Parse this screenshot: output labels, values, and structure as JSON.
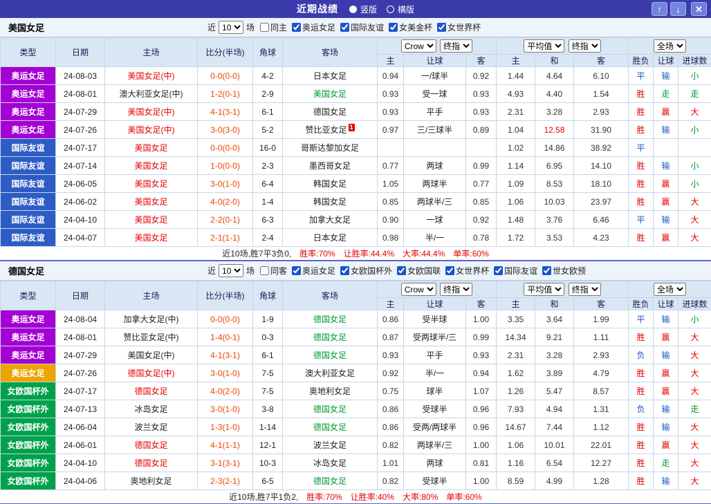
{
  "titlebar": {
    "title": "近期战绩",
    "layout_radios": [
      {
        "label": "竖版",
        "selected": true
      },
      {
        "label": "横版",
        "selected": false
      }
    ],
    "up_button": "↑",
    "down_button": "↓",
    "close_button": "✕"
  },
  "colors": {
    "accent": "#3b3bab",
    "type_purple": "#a400d3",
    "type_blue": "#2d5cc5",
    "type_green": "#00a14b",
    "type_gold": "#eba400",
    "team_red": "#e60000",
    "team_green": "#009933",
    "team_dark": "#222222",
    "score_red": "#ee4400",
    "result_red": "#e60000",
    "result_blue": "#1a56c8",
    "result_green": "#009933",
    "highlight_red": "#e60000"
  },
  "table_header": {
    "static_cols": [
      "类型",
      "日期",
      "主场",
      "比分(半场)",
      "角球",
      "客场"
    ],
    "odds1_cols": [
      "主",
      "让球",
      "客"
    ],
    "odds2_cols": [
      "主",
      "和",
      "客"
    ],
    "result_cols": [
      "胜负",
      "让球",
      "进球数"
    ]
  },
  "sections": [
    {
      "team": "美国女足",
      "filter": {
        "near": "近",
        "count": "10",
        "unit": "场",
        "checkboxes": [
          {
            "label": "同主",
            "checked": false
          },
          {
            "label": "奥运女足",
            "checked": true
          },
          {
            "label": "国际友谊",
            "checked": true
          },
          {
            "label": "女美金杯",
            "checked": true
          },
          {
            "label": "女世界杯",
            "checked": true
          }
        ]
      },
      "controls": {
        "bookmaker": "Crow",
        "odds1_mode": "终指",
        "avg": "平均值",
        "odds2_mode": "终指",
        "scope": "全场"
      },
      "rows": [
        {
          "type": "奥运女足",
          "tcolor": "purple",
          "date": "24-08-03",
          "home": "美国女足(中)",
          "homeColor": "red",
          "score": "0-0(0-0)",
          "corner": "4-2",
          "away": "日本女足",
          "awayColor": "dark",
          "o1": "0.94",
          "handicap": "一/球半",
          "o2": "0.92",
          "avg1": "1.44",
          "avg2": "4.64",
          "avg3": "6.10",
          "res1": "平",
          "res2": "输",
          "res3": "小"
        },
        {
          "type": "奥运女足",
          "tcolor": "purple",
          "date": "24-08-01",
          "home": "澳大利亚女足(中)",
          "homeColor": "dark",
          "score": "1-2(0-1)",
          "corner": "2-9",
          "away": "美国女足",
          "awayColor": "green",
          "o1": "0.93",
          "handicap": "受一球",
          "o2": "0.93",
          "avg1": "4.93",
          "avg2": "4.40",
          "avg3": "1.54",
          "res1": "胜",
          "res2": "走",
          "res3": "走"
        },
        {
          "type": "奥运女足",
          "tcolor": "purple",
          "date": "24-07-29",
          "home": "美国女足(中)",
          "homeColor": "red",
          "score": "4-1(3-1)",
          "corner": "6-1",
          "away": "德国女足",
          "awayColor": "dark",
          "o1": "0.93",
          "handicap": "平手",
          "o2": "0.93",
          "avg1": "2.31",
          "avg2": "3.28",
          "avg3": "2.93",
          "res1": "胜",
          "res2": "赢",
          "res3": "大"
        },
        {
          "type": "奥运女足",
          "tcolor": "purple",
          "date": "24-07-26",
          "home": "美国女足(中)",
          "homeColor": "red",
          "score": "3-0(3-0)",
          "corner": "5-2",
          "away": "赞比亚女足",
          "awayColor": "dark",
          "badge": "1",
          "o1": "0.97",
          "handicap": "三/三球半",
          "o2": "0.89",
          "avg1": "1.04",
          "avg2": "12.58",
          "avg3": "31.90",
          "hl": [
            "avg2"
          ],
          "res1": "胜",
          "res2": "输",
          "res3": "小"
        },
        {
          "type": "国际友谊",
          "tcolor": "blue",
          "date": "24-07-17",
          "home": "美国女足",
          "homeColor": "red",
          "score": "0-0(0-0)",
          "corner": "16-0",
          "away": "哥斯达黎加女足",
          "awayColor": "dark",
          "o1": "",
          "handicap": "",
          "o2": "",
          "avg1": "1.02",
          "avg2": "14.86",
          "avg3": "38.92",
          "res1": "平",
          "res2": "",
          "res3": ""
        },
        {
          "type": "国际友谊",
          "tcolor": "blue",
          "date": "24-07-14",
          "home": "美国女足",
          "homeColor": "red",
          "score": "1-0(0-0)",
          "corner": "2-3",
          "away": "墨西哥女足",
          "awayColor": "dark",
          "o1": "0.77",
          "handicap": "两球",
          "o2": "0.99",
          "avg1": "1.14",
          "avg2": "6.95",
          "avg3": "14.10",
          "res1": "胜",
          "res2": "输",
          "res3": "小"
        },
        {
          "type": "国际友谊",
          "tcolor": "blue",
          "date": "24-06-05",
          "home": "美国女足",
          "homeColor": "red",
          "score": "3-0(1-0)",
          "corner": "6-4",
          "away": "韩国女足",
          "awayColor": "dark",
          "o1": "1.05",
          "handicap": "两球半",
          "o2": "0.77",
          "avg1": "1.09",
          "avg2": "8.53",
          "avg3": "18.10",
          "res1": "胜",
          "res2": "赢",
          "res3": "小"
        },
        {
          "type": "国际友谊",
          "tcolor": "blue",
          "date": "24-06-02",
          "home": "美国女足",
          "homeColor": "red",
          "score": "4-0(2-0)",
          "corner": "1-4",
          "away": "韩国女足",
          "awayColor": "dark",
          "o1": "0.85",
          "handicap": "两球半/三",
          "o2": "0.85",
          "avg1": "1.06",
          "avg2": "10.03",
          "avg3": "23.97",
          "res1": "胜",
          "res2": "赢",
          "res3": "大"
        },
        {
          "type": "国际友谊",
          "tcolor": "blue",
          "date": "24-04-10",
          "home": "美国女足",
          "homeColor": "red",
          "score": "2-2(0-1)",
          "corner": "6-3",
          "away": "加拿大女足",
          "awayColor": "dark",
          "o1": "0.90",
          "handicap": "一球",
          "o2": "0.92",
          "avg1": "1.48",
          "avg2": "3.76",
          "avg3": "6.46",
          "res1": "平",
          "res2": "输",
          "res3": "大"
        },
        {
          "type": "国际友谊",
          "tcolor": "blue",
          "date": "24-04-07",
          "home": "美国女足",
          "homeColor": "red",
          "score": "2-1(1-1)",
          "corner": "2-4",
          "away": "日本女足",
          "awayColor": "dark",
          "o1": "0.98",
          "handicap": "半/一",
          "o2": "0.78",
          "avg1": "1.72",
          "avg2": "3.53",
          "avg3": "4.23",
          "res1": "胜",
          "res2": "赢",
          "res3": "大"
        }
      ],
      "summary": {
        "prefix": "近10场,胜7平3负0,",
        "stats": [
          "胜率:70%",
          "让胜率:44.4%",
          "大率:44.4%",
          "单率:60%"
        ]
      }
    },
    {
      "team": "德国女足",
      "filter": {
        "near": "近",
        "count": "10",
        "unit": "场",
        "checkboxes": [
          {
            "label": "同客",
            "checked": false
          },
          {
            "label": "奥运女足",
            "checked": true
          },
          {
            "label": "女欧国杯外",
            "checked": true
          },
          {
            "label": "女欧国联",
            "checked": true
          },
          {
            "label": "女世界杯",
            "checked": true
          },
          {
            "label": "国际友谊",
            "checked": true
          },
          {
            "label": "世女欧预",
            "checked": true
          }
        ]
      },
      "controls": {
        "bookmaker": "Crow",
        "odds1_mode": "终指",
        "avg": "平均值",
        "odds2_mode": "终指",
        "scope": "全场"
      },
      "rows": [
        {
          "type": "奥运女足",
          "tcolor": "purple",
          "date": "24-08-04",
          "home": "加拿大女足(中)",
          "homeColor": "dark",
          "score": "0-0(0-0)",
          "corner": "1-9",
          "away": "德国女足",
          "awayColor": "green",
          "o1": "0.86",
          "handicap": "受半球",
          "o2": "1.00",
          "avg1": "3.35",
          "avg2": "3.64",
          "avg3": "1.99",
          "res1": "平",
          "res2": "输",
          "res3": "小"
        },
        {
          "type": "奥运女足",
          "tcolor": "purple",
          "date": "24-08-01",
          "home": "赞比亚女足(中)",
          "homeColor": "dark",
          "score": "1-4(0-1)",
          "corner": "0-3",
          "away": "德国女足",
          "awayColor": "green",
          "o1": "0.87",
          "handicap": "受两球半/三",
          "o2": "0.99",
          "avg1": "14.34",
          "avg2": "9.21",
          "avg3": "1.11",
          "res1": "胜",
          "res2": "赢",
          "res3": "大"
        },
        {
          "type": "奥运女足",
          "tcolor": "purple",
          "date": "24-07-29",
          "home": "美国女足(中)",
          "homeColor": "dark",
          "score": "4-1(3-1)",
          "corner": "6-1",
          "away": "德国女足",
          "awayColor": "green",
          "o1": "0.93",
          "handicap": "平手",
          "o2": "0.93",
          "avg1": "2.31",
          "avg2": "3.28",
          "avg3": "2.93",
          "res1": "负",
          "res2": "输",
          "res3": "大"
        },
        {
          "type": "奥运女足",
          "tcolor": "gold",
          "date": "24-07-26",
          "home": "德国女足(中)",
          "homeColor": "red",
          "score": "3-0(1-0)",
          "corner": "7-5",
          "away": "澳大利亚女足",
          "awayColor": "dark",
          "o1": "0.92",
          "handicap": "半/一",
          "o2": "0.94",
          "avg1": "1.62",
          "avg2": "3.89",
          "avg3": "4.79",
          "res1": "胜",
          "res2": "赢",
          "res3": "大"
        },
        {
          "type": "女欧国杯外",
          "tcolor": "green",
          "date": "24-07-17",
          "home": "德国女足",
          "homeColor": "red",
          "score": "4-0(2-0)",
          "corner": "7-5",
          "away": "奥地利女足",
          "awayColor": "dark",
          "o1": "0.75",
          "handicap": "球半",
          "o2": "1.07",
          "avg1": "1.26",
          "avg2": "5.47",
          "avg3": "8.57",
          "res1": "胜",
          "res2": "赢",
          "res3": "大"
        },
        {
          "type": "女欧国杯外",
          "tcolor": "green",
          "date": "24-07-13",
          "home": "冰岛女足",
          "homeColor": "dark",
          "score": "3-0(1-0)",
          "corner": "3-8",
          "away": "德国女足",
          "awayColor": "green",
          "o1": "0.86",
          "handicap": "受球半",
          "o2": "0.96",
          "avg1": "7.93",
          "avg2": "4.94",
          "avg3": "1.31",
          "res1": "负",
          "res2": "输",
          "res3": "走"
        },
        {
          "type": "女欧国杯外",
          "tcolor": "green",
          "date": "24-06-04",
          "home": "波兰女足",
          "homeColor": "dark",
          "score": "1-3(1-0)",
          "corner": "1-14",
          "away": "德国女足",
          "awayColor": "green",
          "o1": "0.86",
          "handicap": "受两/两球半",
          "o2": "0.96",
          "avg1": "14.67",
          "avg2": "7.44",
          "avg3": "1.12",
          "res1": "胜",
          "res2": "输",
          "res3": "大"
        },
        {
          "type": "女欧国杯外",
          "tcolor": "green",
          "date": "24-06-01",
          "home": "德国女足",
          "homeColor": "red",
          "score": "4-1(1-1)",
          "corner": "12-1",
          "away": "波兰女足",
          "awayColor": "dark",
          "o1": "0.82",
          "handicap": "两球半/三",
          "o2": "1.00",
          "avg1": "1.06",
          "avg2": "10.01",
          "avg3": "22.01",
          "res1": "胜",
          "res2": "赢",
          "res3": "大"
        },
        {
          "type": "女欧国杯外",
          "tcolor": "green",
          "date": "24-04-10",
          "home": "德国女足",
          "homeColor": "red",
          "score": "3-1(3-1)",
          "corner": "10-3",
          "away": "冰岛女足",
          "awayColor": "dark",
          "o1": "1.01",
          "handicap": "两球",
          "o2": "0.81",
          "avg1": "1.16",
          "avg2": "6.54",
          "avg3": "12.27",
          "res1": "胜",
          "res2": "走",
          "res3": "大"
        },
        {
          "type": "女欧国杯外",
          "tcolor": "green",
          "date": "24-04-06",
          "home": "奥地利女足",
          "homeColor": "dark",
          "score": "2-3(2-1)",
          "corner": "6-5",
          "away": "德国女足",
          "awayColor": "green",
          "o1": "0.82",
          "handicap": "受球半",
          "o2": "1.00",
          "avg1": "8.59",
          "avg2": "4.99",
          "avg3": "1.28",
          "res1": "胜",
          "res2": "输",
          "res3": "大"
        }
      ],
      "summary": {
        "prefix": "近10场,胜7平1负2,",
        "stats": [
          "胜率:70%",
          "让胜率:40%",
          "大率:80%",
          "单率:60%"
        ]
      }
    }
  ]
}
